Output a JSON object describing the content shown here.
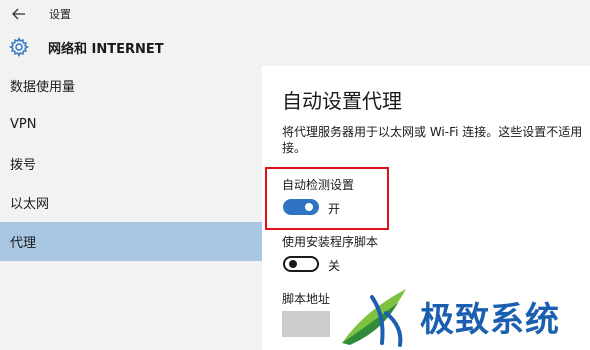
{
  "window": {
    "title": "设置"
  },
  "header": {
    "title": "网络和 INTERNET"
  },
  "sidebar": {
    "items": [
      {
        "label": "数据使用量"
      },
      {
        "label": "VPN"
      },
      {
        "label": "拨号"
      },
      {
        "label": "以太网"
      },
      {
        "label": "代理"
      }
    ],
    "active": "代理"
  },
  "main": {
    "section_title": "自动设置代理",
    "description_line1": "将代理服务器用于以太网或 Wi-Fi 连接。这些设置不适用",
    "description_line2": "接。",
    "auto_detect": {
      "label": "自动检测设置",
      "state": "开",
      "on": true
    },
    "setup_script": {
      "label": "使用安装程序脚本",
      "state": "关",
      "on": false
    },
    "script_address": {
      "label": "脚本地址",
      "value": ""
    }
  },
  "watermark": {
    "text": "极致系统"
  },
  "colors": {
    "accent": "#2e74c2",
    "active_nav": "#a9c6e3",
    "highlight": "#e0101a",
    "sidebar_bg": "#f2f2f2"
  },
  "icons": {
    "back": "back-arrow-icon",
    "settings": "gear-icon",
    "watermark_logo": "leaf-logo-icon"
  }
}
